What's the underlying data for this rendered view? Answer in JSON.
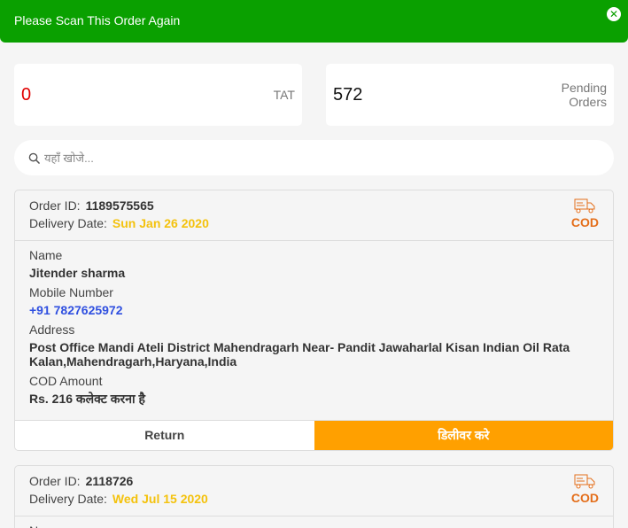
{
  "toast": {
    "message": "Please Scan This Order Again",
    "close_icon": "close-icon"
  },
  "stats": {
    "tat": {
      "value": "0",
      "label": "TAT"
    },
    "pending": {
      "value": "572",
      "label_line1": "Pending",
      "label_line2": "Orders"
    }
  },
  "search": {
    "placeholder": "यहाँ खोजे..."
  },
  "labels": {
    "order_id": "Order ID:",
    "delivery_date": "Delivery Date:",
    "cod": "COD",
    "name": "Name",
    "mobile": "Mobile Number",
    "address": "Address",
    "cod_amount": "COD Amount",
    "return": "Return",
    "deliver": "डिलीवर करे"
  },
  "orders": [
    {
      "order_id": "1189575565",
      "delivery_date": "Sun Jan 26 2020",
      "name": "Jitender sharma",
      "mobile": "+91 7827625972",
      "address": "Post Office Mandi Ateli District Mahendragarh Near- Pandit Jawaharlal Kisan Indian Oil Rata Kalan,Mahendragarh,Haryana,India",
      "cod_amount": "Rs. 216 कलेक्ट करना है"
    },
    {
      "order_id": "2118726",
      "delivery_date": "Wed Jul 15 2020"
    }
  ],
  "colors": {
    "toast_bg": "#0aa000",
    "deliver_bg": "#ffa000",
    "date": "#f4c20d",
    "cod": "#e46e1a",
    "phone": "#3050e0",
    "tat": "#e00000"
  }
}
